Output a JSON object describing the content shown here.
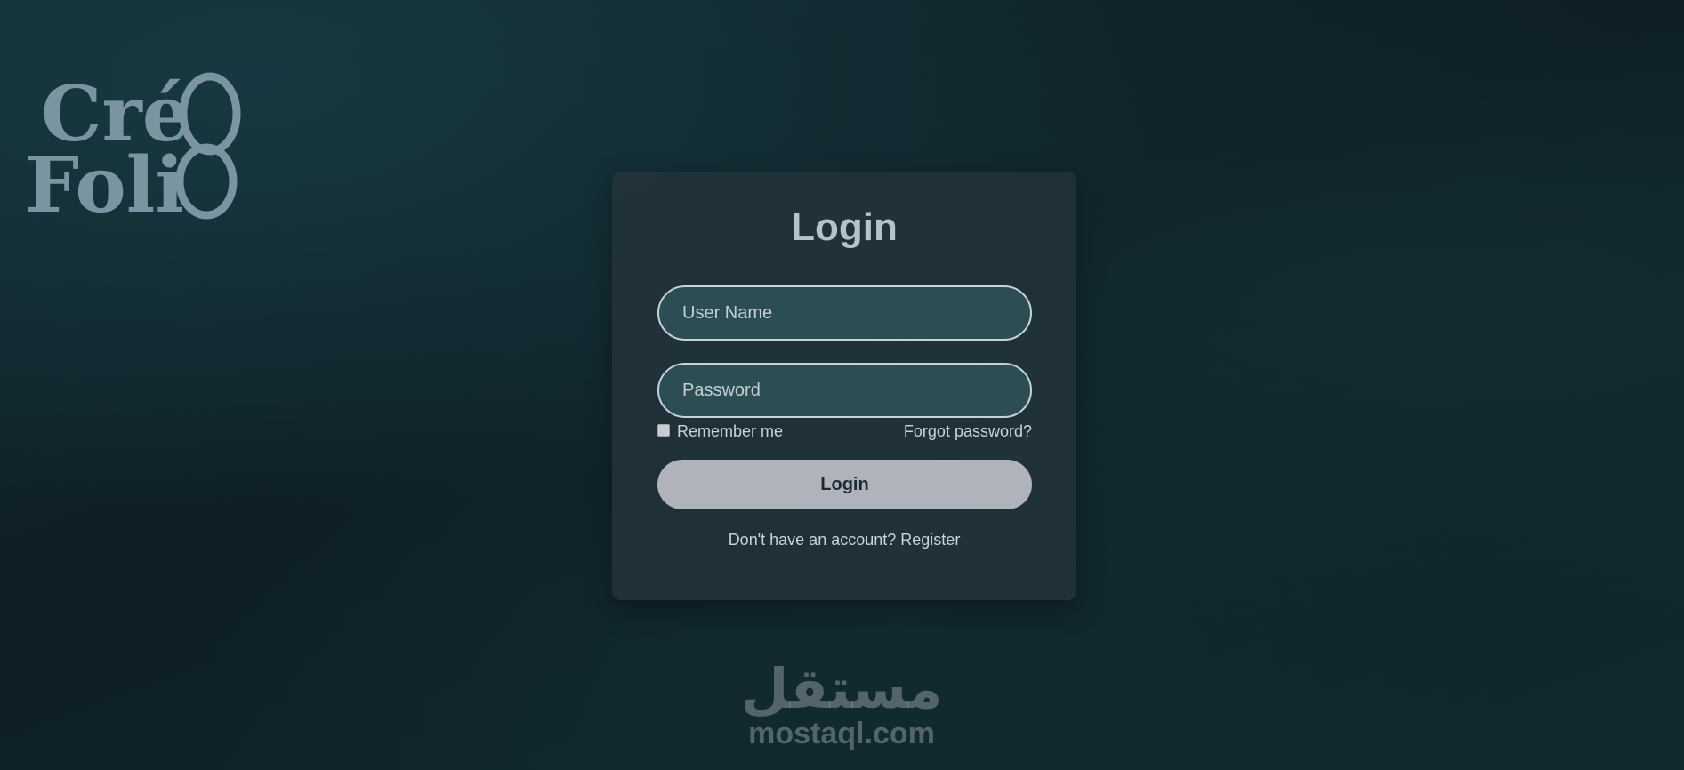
{
  "logo": {
    "line1": "Cré",
    "line2": "Foli",
    "icon": "creofolio-logo",
    "color": "#7a94a2"
  },
  "login": {
    "title": "Login",
    "username_placeholder": "User Name",
    "password_placeholder": "Password",
    "remember_label": "Remember me",
    "forgot_link": "Forgot password?",
    "submit_label": "Login",
    "register_prompt": "Don't have an account?",
    "register_link": "Register"
  },
  "watermark": {
    "arabic": "مستقل",
    "latin": "mostaql.com"
  },
  "colors": {
    "background": "#0f2329",
    "card": "#23323a",
    "field": "#2d4d55",
    "button": "#b0b3bc",
    "text": "#c9d4d8"
  }
}
